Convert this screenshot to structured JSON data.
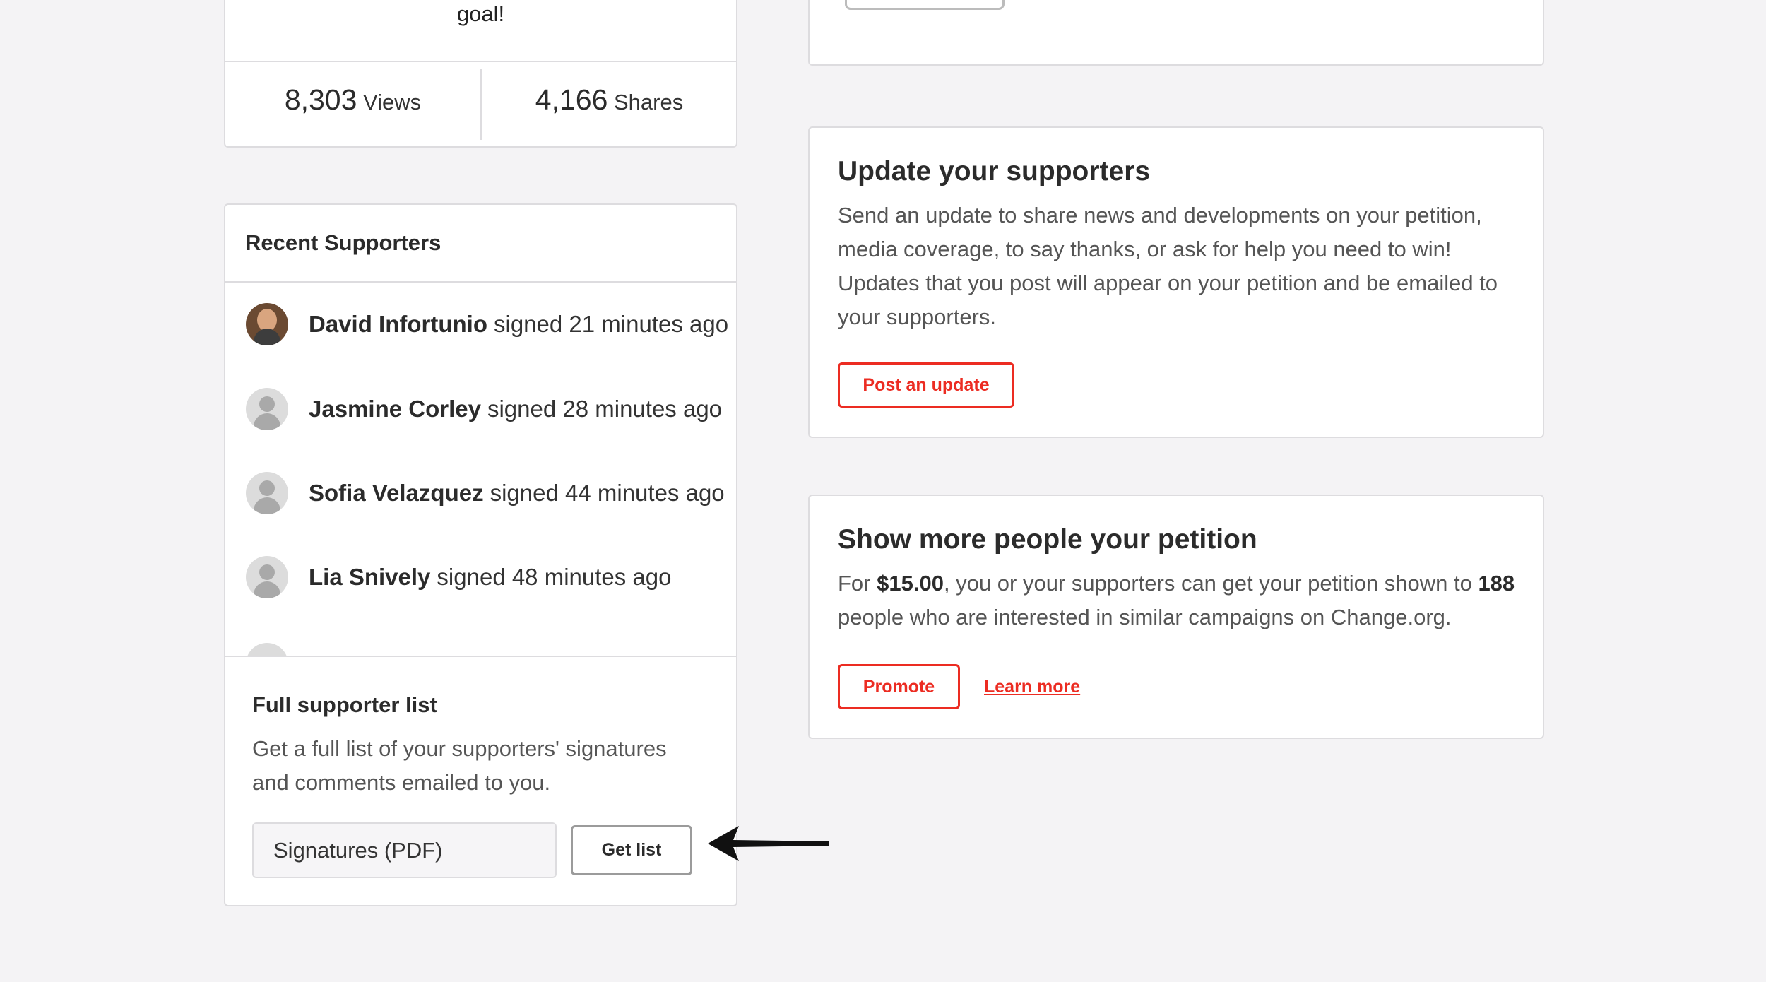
{
  "stats": {
    "goal_text": "goal!",
    "views_count": "8,303",
    "views_label": "Views",
    "shares_count": "4,166",
    "shares_label": "Shares"
  },
  "recent_supporters": {
    "title": "Recent Supporters",
    "items": [
      {
        "name": "David Infortunio",
        "action": "signed 21 minutes ago",
        "avatar": "photo"
      },
      {
        "name": "Jasmine Corley",
        "action": "signed 28 minutes ago",
        "avatar": "default-person-icon"
      },
      {
        "name": "Sofia Velazquez",
        "action": "signed 44 minutes ago",
        "avatar": "default-person-icon"
      },
      {
        "name": "Lia Snively",
        "action": "signed 48 minutes ago",
        "avatar": "default-person-icon"
      }
    ]
  },
  "full_list": {
    "title": "Full supporter list",
    "description": "Get a full list of your supporters' signatures and comments emailed to you.",
    "format_selected": "Signatures (PDF)",
    "button_label": "Get list"
  },
  "update_card": {
    "title": "Update your supporters",
    "description": "Send an update to share news and developments on your petition, media coverage, to say thanks, or ask for help you need to win! Updates that you post will appear on your petition and be emailed to your supporters.",
    "button_label": "Post an update"
  },
  "promote_card": {
    "title": "Show more people your petition",
    "desc_part1": "For ",
    "price": "$15.00",
    "desc_part2": ", you or your supporters can get your petition shown to ",
    "people_count": "188",
    "desc_part3": " people who are interested in similar campaigns on Change.org.",
    "button_label": "Promote",
    "link_label": "Learn more"
  },
  "colors": {
    "accent": "#ec2c22",
    "background": "#f4f3f5",
    "border": "#dddcdf"
  }
}
